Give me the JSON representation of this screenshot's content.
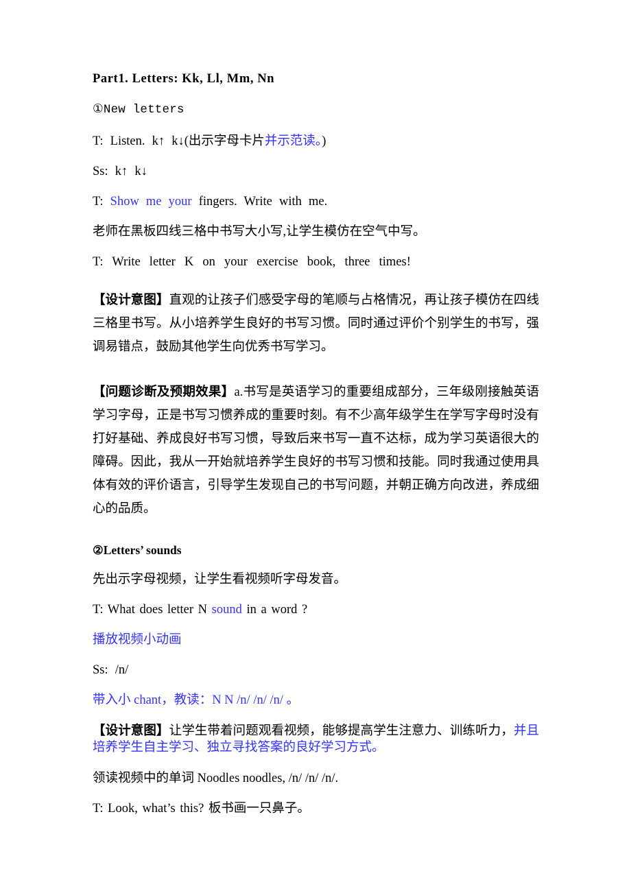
{
  "document": {
    "type": "lesson-plan",
    "language": "zh-CN/en",
    "page_background": "#ffffff",
    "text_color": "#000000",
    "accent_color": "#3333ff"
  },
  "title": "Part1. Letters: Kk, Ll, Mm, Nn",
  "section1": {
    "heading": "①New letters",
    "line_teacher_listen_pre": "T: Listen. k↑ k↓(出示字母卡片",
    "line_teacher_listen_blue": "并示范读。",
    "line_teacher_listen_post": ")",
    "line_students": "Ss: k↑ k↓",
    "line_show_prefix": "T: ",
    "line_show_blue": "Show me your",
    "line_show_rest": " fingers. Write with me.",
    "line_board_note": "老师在黑板四线三格中书写大小写,让学生模仿在空气中写。",
    "line_write_k": "T: Write   letter K on your exercise book, three times!",
    "design_label": "【设计意图】",
    "design_body": "直观的让孩子们感受字母的笔顺与占格情况，再让孩子模仿在四线三格里书写。从小培养学生良好的书写习惯。同时通过评价个别学生的书写，强调易错点，鼓励其他学生向优秀书写学习。",
    "diagnosis_label": "【问题诊断及预期效果】",
    "diagnosis_body": "a.书写是英语学习的重要组成部分，三年级刚接触英语学习字母，正是书写习惯养成的重要时刻。有不少高年级学生在学写字母时没有打好基础、养成良好书写习惯，导致后来书写一直不达标，成为学习英语很大的障碍。因此，我从一开始就培养学生良好的书写习惯和技能。同时我通过使用具体有效的评价语言，引导学生发现自己的书写问题，并朝正确方向改进，养成细心的品质。"
  },
  "section2": {
    "heading": "②Letters’ sounds",
    "line_video_intro": "先出示字母视频，让学生看视频听字母发音。",
    "line_question_pre": "T: What does letter N ",
    "line_question_blue": "sound",
    "line_question_post": " in a word ?",
    "line_play_video": "播放视频小动画",
    "line_students_sound": "Ss: /n/",
    "line_chant": "带入小 chant，教读：N N   /n/ /n/ /n/ 。",
    "design_label": "【设计意图】",
    "design_body_black": "让学生带着问题观看视频，能够提高学生注意力、训练听力，",
    "design_body_blue": "并且培养学生自主学习、独立寻找答案的良好学习方式。",
    "line_lead_read": "领读视频中的单词 Noodles noodles, /n/ /n/ /n/.",
    "line_look": "T: Look, what’s this?   板书画一只鼻子。"
  }
}
